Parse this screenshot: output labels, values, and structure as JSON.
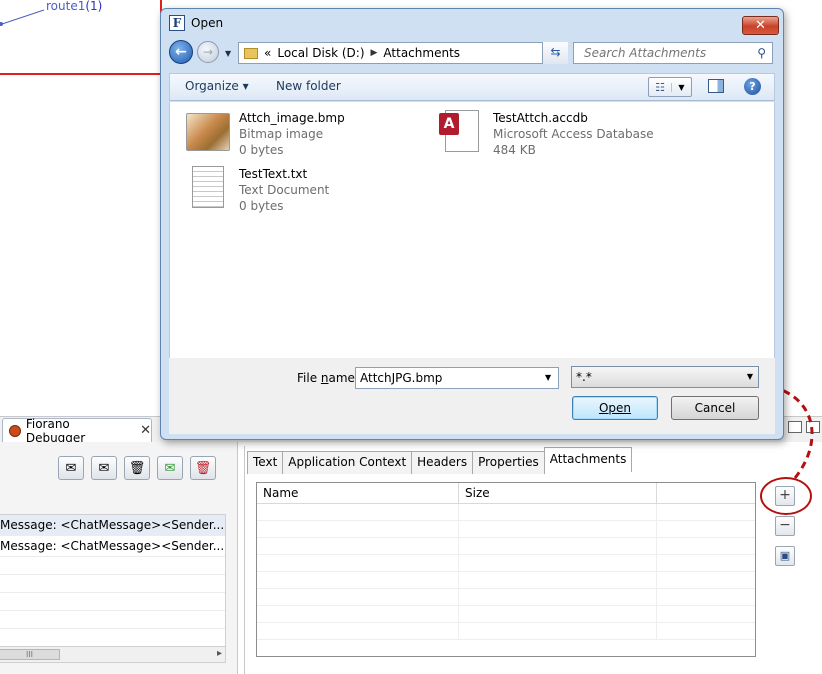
{
  "canvas": {
    "route_name": "route1",
    "route_index": "(1)"
  },
  "dialog": {
    "title": "Open",
    "close_glyph": "✕",
    "address": {
      "prefix": "«",
      "crumbs": [
        "Local Disk (D:)",
        "Attachments"
      ]
    },
    "search_placeholder": "Search Attachments",
    "toolbar": {
      "organize": "Organize ▾",
      "new_folder": "New folder",
      "help": "?"
    },
    "files": [
      {
        "name": "Attch_image.bmp",
        "type": "Bitmap image",
        "size": "0 bytes",
        "icon": "bitmap-file-icon"
      },
      {
        "name": "TestAttch.accdb",
        "type": "Microsoft Access Database",
        "size": "484 KB",
        "icon": "access-file-icon"
      },
      {
        "name": "TestText.txt",
        "type": "Text Document",
        "size": "0 bytes",
        "icon": "text-file-icon"
      }
    ],
    "file_name_label_pre": "File ",
    "file_name_label_u": "n",
    "file_name_label_post": "ame:",
    "file_name_value": "AttchJPG.bmp",
    "filter_value": "*.*",
    "open_label": "Open",
    "cancel_label": "Cancel"
  },
  "debugger": {
    "tab_label": "Fiorano Debugger",
    "tab_close": "✕",
    "messages": [
      "Message: <ChatMessage><Sender...",
      "Message: <ChatMessage><Sender..."
    ],
    "scroll_thumb": "III"
  },
  "details": {
    "tabs": [
      "Text",
      "Application Context",
      "Headers",
      "Properties",
      "Attachments"
    ],
    "active_tab": "Attachments",
    "columns": [
      "Name",
      "Size"
    ],
    "add_glyph": "+",
    "remove_glyph": "−"
  },
  "colors": {
    "annotation_red": "#b51010",
    "accent_blue": "#3c7fb1"
  }
}
